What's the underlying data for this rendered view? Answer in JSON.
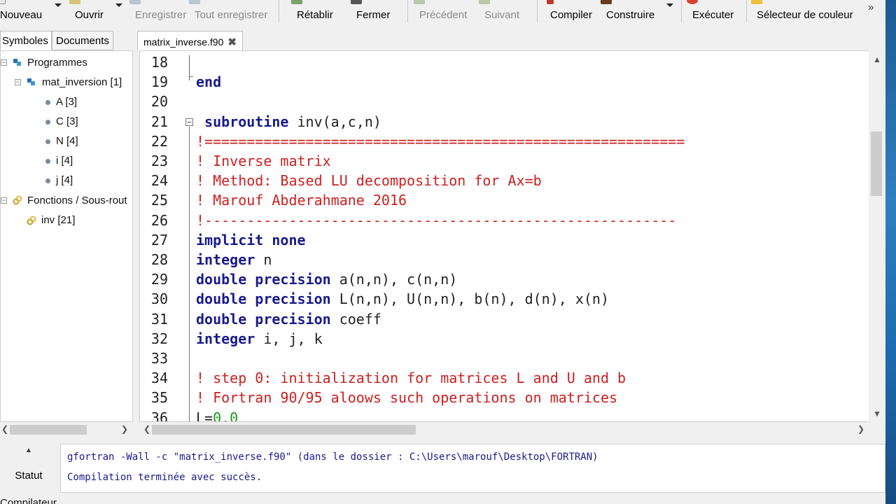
{
  "toolbar": {
    "items": [
      {
        "label": "Nouveau",
        "enabled": true,
        "icon": "new-file-icon"
      },
      {
        "label": "Ouvrir",
        "enabled": true,
        "icon": "open-folder-icon"
      },
      {
        "label": "Enregistrer",
        "enabled": false,
        "icon": "save-icon"
      },
      {
        "label": "Tout enregistrer",
        "enabled": false,
        "icon": "save-all-icon"
      },
      {
        "label": "Rétablir",
        "enabled": true,
        "icon": "redo-icon"
      },
      {
        "label": "Fermer",
        "enabled": true,
        "icon": "close-icon"
      },
      {
        "label": "Précédent",
        "enabled": false,
        "icon": "arrow-left-icon"
      },
      {
        "label": "Suivant",
        "enabled": false,
        "icon": "arrow-right-icon"
      },
      {
        "label": "Compiler",
        "enabled": true,
        "icon": "compile-icon"
      },
      {
        "label": "Construire",
        "enabled": true,
        "icon": "build-icon"
      },
      {
        "label": "Exécuter",
        "enabled": true,
        "icon": "run-icon"
      },
      {
        "label": "Sélecteur de couleur",
        "enabled": true,
        "icon": "color-picker-icon"
      }
    ],
    "more": "»"
  },
  "sidebar": {
    "tabs": [
      "Symboles",
      "Documents"
    ],
    "tree": [
      {
        "label": "Programmes",
        "icon": "program-icon",
        "expanded": true
      },
      {
        "label": "mat_inversion [1]",
        "icon": "program-icon",
        "expanded": true
      },
      {
        "label": "A [3]",
        "icon": "variable-icon"
      },
      {
        "label": "C [3]",
        "icon": "variable-icon"
      },
      {
        "label": "N [4]",
        "icon": "variable-icon"
      },
      {
        "label": "i [4]",
        "icon": "variable-icon"
      },
      {
        "label": "j [4]",
        "icon": "variable-icon"
      },
      {
        "label": "Fonctions / Sous-rout",
        "icon": "function-icon",
        "expanded": true
      },
      {
        "label": "inv [21]",
        "icon": "function-icon"
      }
    ]
  },
  "editor": {
    "tab": "matrix_inverse.f90",
    "lines": [
      {
        "n": "18",
        "code": ""
      },
      {
        "n": "19",
        "code": "end"
      },
      {
        "n": "20",
        "code": ""
      },
      {
        "n": "21",
        "code": " subroutine inv(a,c,n)"
      },
      {
        "n": "22",
        "code": "!========================================================="
      },
      {
        "n": "23",
        "code": "! Inverse matrix"
      },
      {
        "n": "24",
        "code": "! Method: Based LU decomposition for Ax=b"
      },
      {
        "n": "25",
        "code": "! Marouf Abderahmane 2016"
      },
      {
        "n": "26",
        "code": "!--------------------------------------------------------"
      },
      {
        "n": "27",
        "code": "implicit none"
      },
      {
        "n": "28",
        "code": "integer n"
      },
      {
        "n": "29",
        "code": "double precision a(n,n), c(n,n)"
      },
      {
        "n": "30",
        "code": "double precision L(n,n), U(n,n), b(n), d(n), x(n)"
      },
      {
        "n": "31",
        "code": "double precision coeff"
      },
      {
        "n": "32",
        "code": "integer i, j, k"
      },
      {
        "n": "33",
        "code": ""
      },
      {
        "n": "34",
        "code": "! step 0: initialization for matrices L and U and b"
      },
      {
        "n": "35",
        "code": "! Fortran 90/95 aloows such operations on matrices"
      },
      {
        "n": "36",
        "code": "L=0.0"
      }
    ]
  },
  "output": {
    "tab": "Statut",
    "lines": [
      "gfortran -Wall -c \"matrix_inverse.f90\" (dans le dossier : C:\\Users\\marouf\\Desktop\\FORTRAN)",
      "Compilation terminée avec succès."
    ],
    "next_tab": "Compilateur"
  },
  "colors": {
    "keyword": "#1a1a8c",
    "comment": "#cc2020",
    "number": "#1a9a1a"
  }
}
